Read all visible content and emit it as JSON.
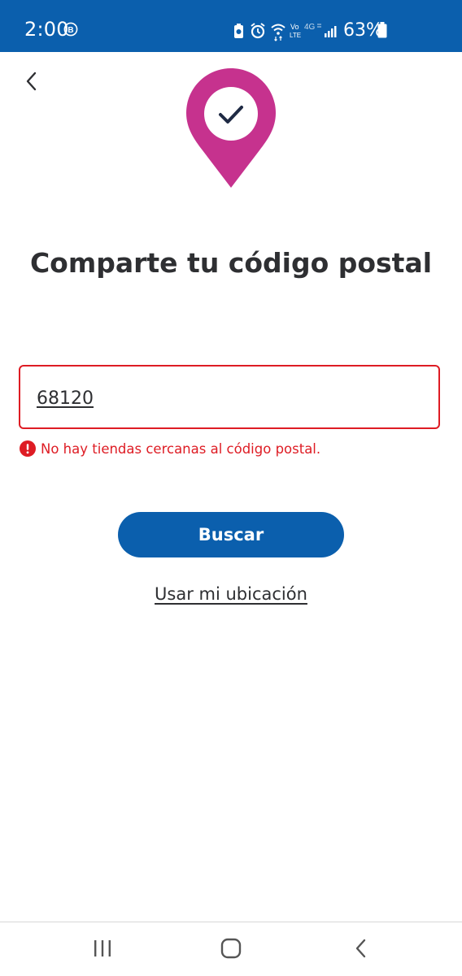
{
  "status_bar": {
    "time": "2:00",
    "battery": "63%",
    "icons": [
      "b-icon",
      "battery-saver-icon",
      "alarm-icon",
      "wifi-icon",
      "volte-icon",
      "4g-icon",
      "signal-icon",
      "battery-icon"
    ],
    "volte_top": "Vo",
    "volte_bottom": "LTE",
    "network": "4G"
  },
  "header": {
    "back_icon": "chevron-left-icon",
    "hero_icon": "map-pin-check-icon"
  },
  "main": {
    "title": "Comparte tu código postal",
    "postal_code_value": "68120",
    "error_message": "No hay tiendas cercanas al código postal.",
    "search_button_label": "Buscar",
    "use_location_label": "Usar mi ubicación"
  },
  "nav_bar": {
    "icons": [
      "recent-apps-icon",
      "home-icon",
      "back-icon"
    ]
  },
  "colors": {
    "brand_blue": "#0b5fad",
    "pin_pink": "#c6328e",
    "error_red": "#de1c24",
    "text_dark": "#2e2f32"
  }
}
